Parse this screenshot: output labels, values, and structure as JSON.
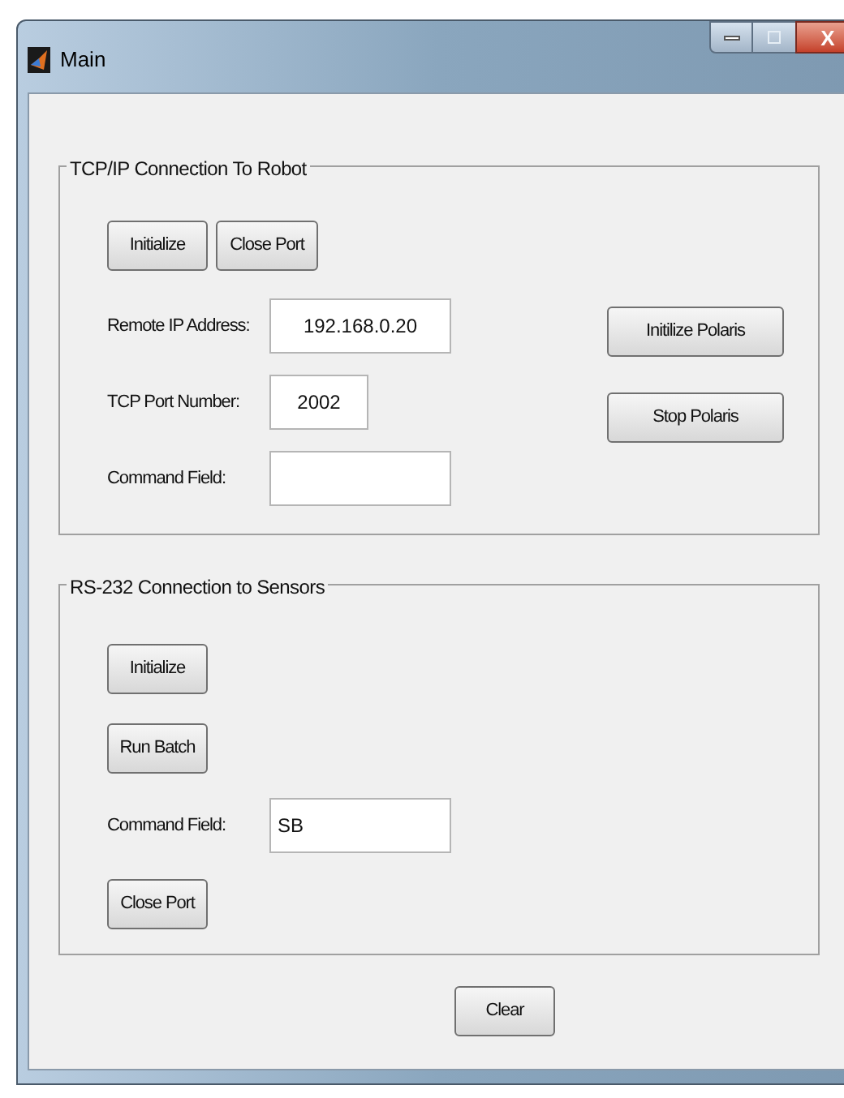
{
  "window": {
    "title": "Main",
    "controls": [
      {
        "kind": "minimize"
      },
      {
        "kind": "maximize"
      },
      {
        "kind": "close",
        "label": "X"
      }
    ]
  },
  "tcp_group": {
    "title": "TCP/IP Connection To Robot",
    "top_buttons": [
      "Initialize",
      "Close Port"
    ],
    "fields": [
      {
        "label": "Remote IP Address:",
        "value": "192.168.0.20",
        "kind": "wide"
      },
      {
        "label": "TCP Port Number:",
        "value": "2002",
        "kind": "narrow"
      },
      {
        "label": "Command Field:",
        "kind": "wide"
      }
    ],
    "side_buttons": [
      "Initilize Polaris",
      "Stop Polaris"
    ]
  },
  "serial_group": {
    "title": "RS-232 Connection to Sensors",
    "buttons": [
      "Initialize",
      "Run Batch"
    ],
    "field": {
      "label": "Command Field:",
      "value": "SB"
    },
    "bottom_button": "Close Port"
  },
  "clear_button": "Clear"
}
